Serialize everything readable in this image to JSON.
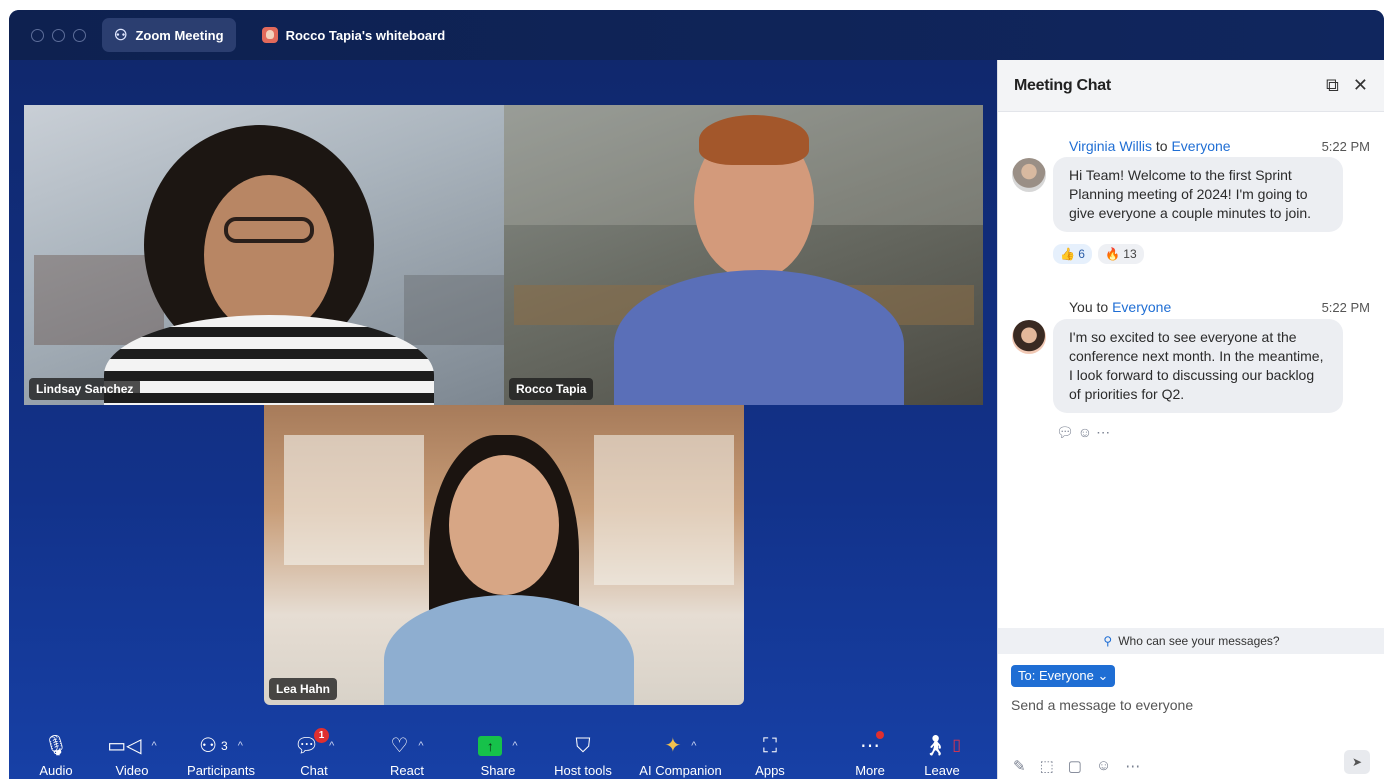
{
  "titlebar": {
    "active_tab": "Zoom Meeting",
    "second_tab": "Rocco Tapia's whiteboard"
  },
  "participants": [
    {
      "name": "Lindsay Sanchez"
    },
    {
      "name": "Rocco Tapia"
    },
    {
      "name": "Lea Hahn"
    }
  ],
  "toolbar": {
    "audio": "Audio",
    "video": "Video",
    "participants": "Participants",
    "participants_count": "3",
    "chat": "Chat",
    "chat_badge": "1",
    "react": "React",
    "share": "Share",
    "host_tools": "Host tools",
    "ai_companion": "AI Companion",
    "apps": "Apps",
    "more": "More",
    "leave": "Leave"
  },
  "chat": {
    "title": "Meeting Chat",
    "messages": [
      {
        "sender": "Virginia Willis",
        "to_word": "to",
        "recipient": "Everyone",
        "time": "5:22 PM",
        "text": "Hi Team! Welcome to the first Sprint Planning meeting of 2024! I'm going to give everyone a couple minutes to join.",
        "reactions": [
          {
            "emoji": "👍",
            "count": "6"
          },
          {
            "emoji": "🔥",
            "count": "13"
          }
        ]
      },
      {
        "sender": "You",
        "to_word": "to",
        "recipient": "Everyone",
        "time": "5:22 PM",
        "text": "I'm so excited to see everyone at the conference next month. In the meantime, I look forward to discussing our backlog of priorities for Q2."
      }
    ],
    "who_can_see": "Who can see your messages?",
    "to_button": "To: Everyone ⌄",
    "input_placeholder": "Send a message to everyone"
  },
  "colors": {
    "accent": "#1f6ed4",
    "stage_bg": "#12328a",
    "share_green": "#16c24a",
    "alert_red": "#e02f2f"
  }
}
